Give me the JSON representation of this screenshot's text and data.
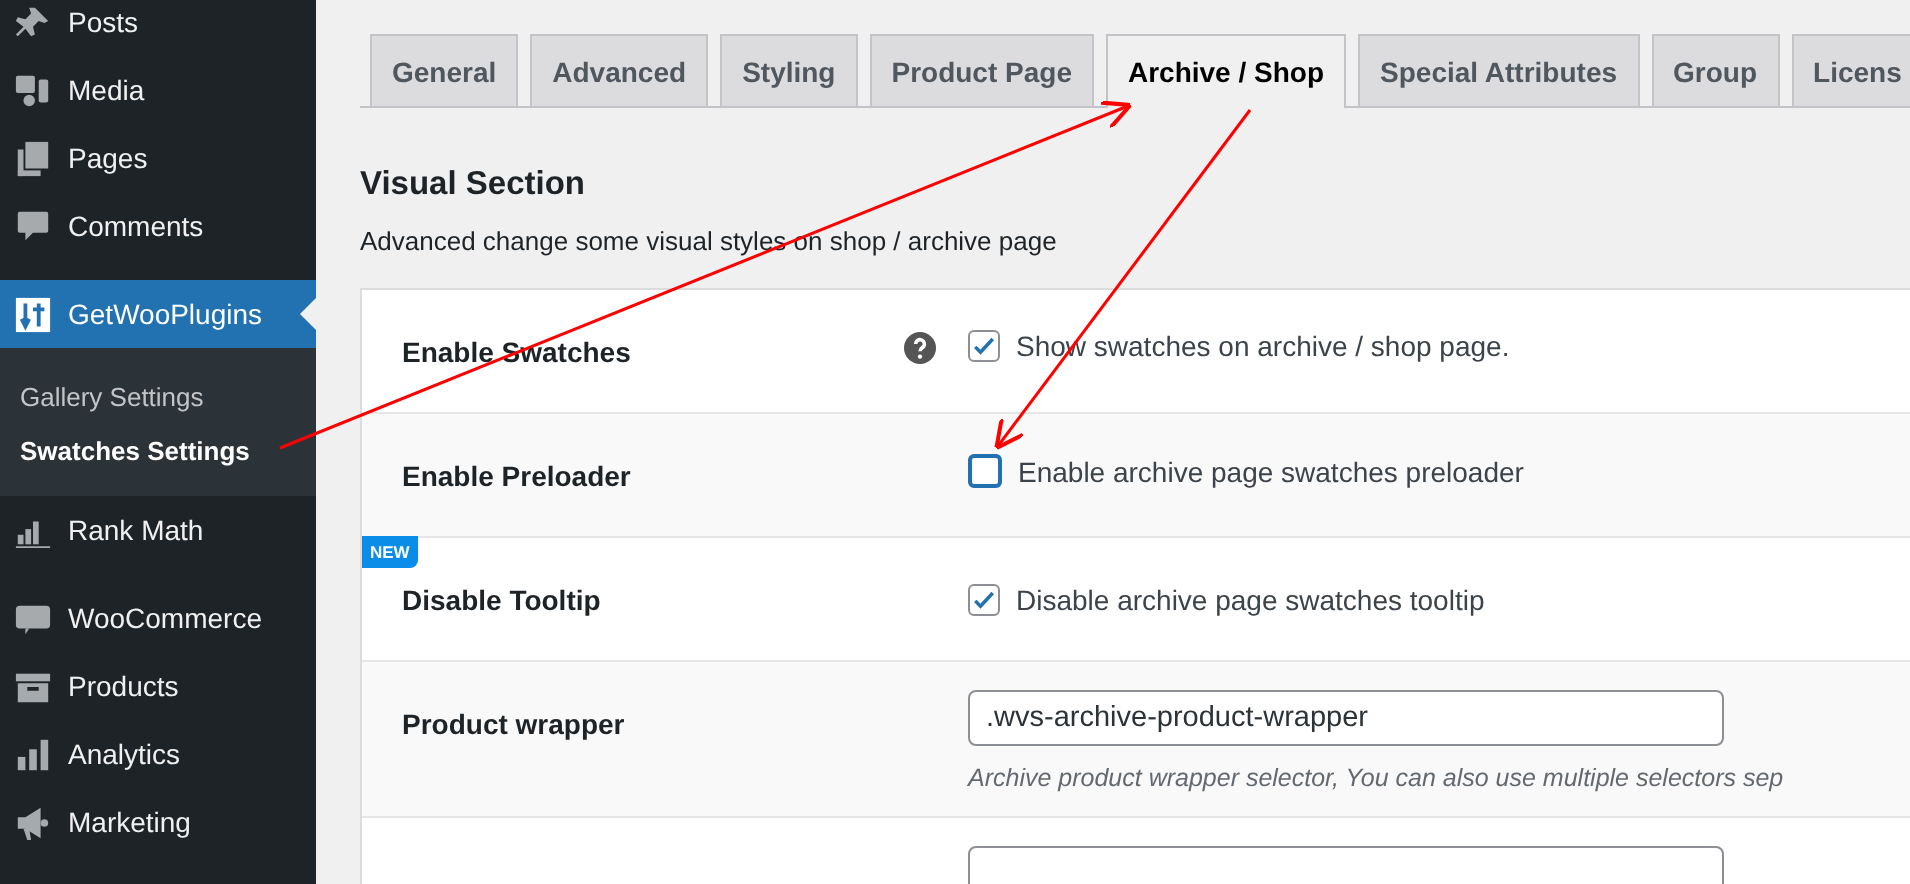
{
  "sidebar": {
    "groups": [
      [
        {
          "label": "Posts",
          "selected": false
        },
        {
          "label": "Media",
          "selected": false
        },
        {
          "label": "Pages",
          "selected": false
        },
        {
          "label": "Comments",
          "selected": false
        }
      ],
      [
        {
          "label": "GetWooPlugins",
          "selected": true,
          "children": [
            {
              "label": "Gallery Settings",
              "selected": false
            },
            {
              "label": "Swatches Settings",
              "selected": true
            }
          ]
        },
        {
          "label": "Rank Math",
          "selected": false
        }
      ],
      [
        {
          "label": "WooCommerce",
          "selected": false
        },
        {
          "label": "Products",
          "selected": false
        },
        {
          "label": "Analytics",
          "selected": false
        },
        {
          "label": "Marketing",
          "selected": false
        }
      ]
    ]
  },
  "tabs": [
    {
      "label": "General",
      "selected": false
    },
    {
      "label": "Advanced",
      "selected": false
    },
    {
      "label": "Styling",
      "selected": false
    },
    {
      "label": "Product Page",
      "selected": false
    },
    {
      "label": "Archive / Shop",
      "selected": true
    },
    {
      "label": "Special Attributes",
      "selected": false
    },
    {
      "label": "Group",
      "selected": false
    },
    {
      "label": "Licens",
      "selected": false
    }
  ],
  "section": {
    "title": "Visual Section",
    "description": "Advanced change some visual styles on shop / archive page"
  },
  "settings": [
    {
      "kind": "checkbox",
      "label": "Enable Swatches",
      "help": true,
      "checked": true,
      "text": "Show swatches on archive / shop page."
    },
    {
      "kind": "checkbox",
      "label": "Enable Preloader",
      "checked": false,
      "text": "Enable archive page swatches preloader"
    },
    {
      "kind": "checkbox",
      "label": "Disable Tooltip",
      "badge": "NEW",
      "checked": true,
      "text": "Disable archive page swatches tooltip"
    },
    {
      "kind": "text",
      "label": "Product wrapper",
      "value": ".wvs-archive-product-wrapper",
      "description": "Archive product wrapper selector, You can also use multiple selectors sep"
    },
    {
      "kind": "text"
    }
  ]
}
